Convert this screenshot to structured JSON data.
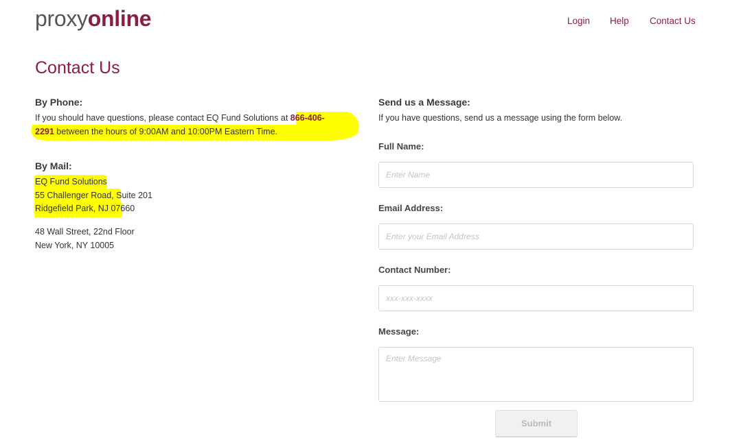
{
  "header": {
    "logo_part1": "proxy",
    "logo_part2": "online",
    "nav": {
      "login": "Login",
      "help": "Help",
      "contact": "Contact Us"
    }
  },
  "page_title": "Contact Us",
  "phone_section": {
    "heading": "By Phone:",
    "text_before": "If you should have questions, please contact EQ Fund Solutions at ",
    "phone_line1": "866-406-",
    "phone_line2": "2291",
    "text_after": " between the hours of 9:00AM and 10:00PM Eastern Time."
  },
  "mail_section": {
    "heading": "By Mail:",
    "address1": [
      "EQ Fund Solutions",
      "55 Challenger Road, Suite 201",
      "Ridgefield Park, NJ 07660"
    ],
    "address2": [
      "48 Wall Street, 22nd Floor",
      "New York, NY 10005"
    ]
  },
  "message_section": {
    "heading": "Send us a Message:",
    "intro": "If you have questions, send us a message using the form below."
  },
  "form": {
    "full_name": {
      "label": "Full Name:",
      "placeholder": "Enter Name",
      "value": ""
    },
    "email": {
      "label": "Email Address:",
      "placeholder": "Enter your Email Address",
      "value": ""
    },
    "contact": {
      "label": "Contact Number:",
      "placeholder": "xxx-xxx-xxxx",
      "value": ""
    },
    "message": {
      "label": "Message:",
      "placeholder": "Enter Message",
      "value": ""
    },
    "submit_label": "Submit"
  },
  "colors": {
    "brand": "#8b1e3f",
    "highlight": "#ffff00",
    "text": "#333333"
  }
}
